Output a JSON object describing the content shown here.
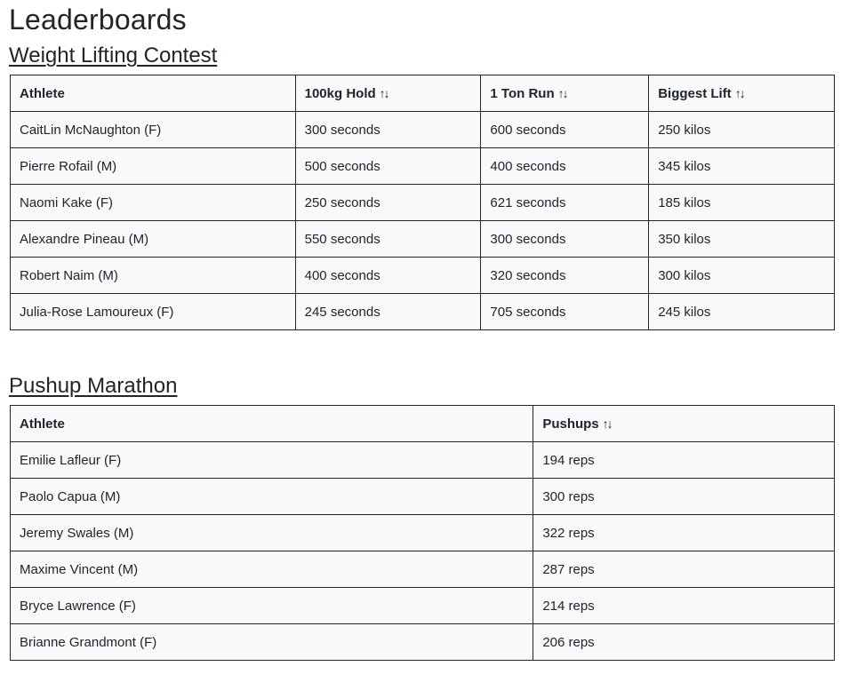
{
  "page": {
    "title": "Leaderboards"
  },
  "weight_lifting": {
    "title": "Weight Lifting Contest",
    "headers": {
      "athlete": "Athlete",
      "hold": "100kg Hold",
      "run": "1 Ton Run",
      "lift": "Biggest Lift"
    },
    "sort_glyph": "↑↓",
    "rows": [
      {
        "athlete": "CaitLin McNaughton (F)",
        "hold": "300 seconds",
        "run": "600 seconds",
        "lift": "250 kilos"
      },
      {
        "athlete": "Pierre Rofail (M)",
        "hold": "500 seconds",
        "run": "400 seconds",
        "lift": "345 kilos"
      },
      {
        "athlete": "Naomi Kake (F)",
        "hold": "250 seconds",
        "run": "621 seconds",
        "lift": "185 kilos"
      },
      {
        "athlete": "Alexandre Pineau (M)",
        "hold": "550 seconds",
        "run": "300 seconds",
        "lift": "350 kilos"
      },
      {
        "athlete": "Robert Naim (M)",
        "hold": "400 seconds",
        "run": "320 seconds",
        "lift": "300 kilos"
      },
      {
        "athlete": "Julia-Rose Lamoureux (F)",
        "hold": "245 seconds",
        "run": "705 seconds",
        "lift": "245 kilos"
      }
    ]
  },
  "pushup": {
    "title": "Pushup Marathon",
    "headers": {
      "athlete": "Athlete",
      "pushups": "Pushups"
    },
    "sort_glyph": "↑↓",
    "rows": [
      {
        "athlete": "Emilie Lafleur (F)",
        "pushups": "194 reps"
      },
      {
        "athlete": "Paolo Capua (M)",
        "pushups": "300 reps"
      },
      {
        "athlete": "Jeremy Swales (M)",
        "pushups": "322 reps"
      },
      {
        "athlete": "Maxime Vincent (M)",
        "pushups": "287 reps"
      },
      {
        "athlete": "Bryce Lawrence (F)",
        "pushups": "214 reps"
      },
      {
        "athlete": "Brianne Grandmont (F)",
        "pushups": "206 reps"
      }
    ]
  }
}
